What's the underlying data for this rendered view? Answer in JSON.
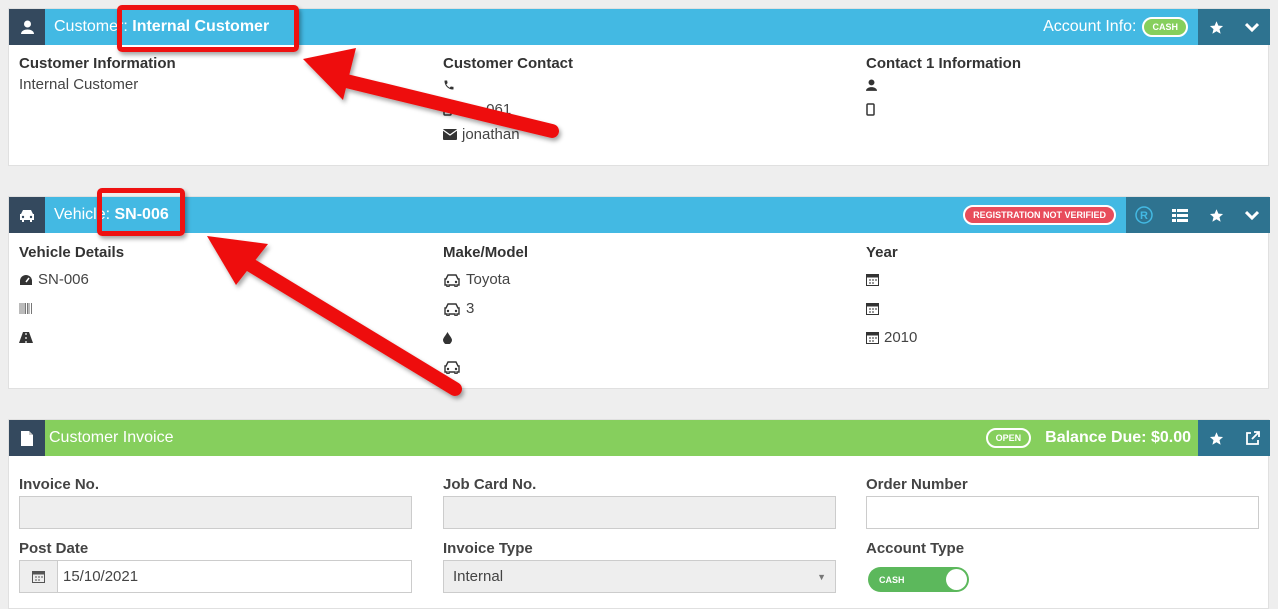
{
  "customer": {
    "title_prefix": "Customer: ",
    "title_name": "Internal Customer",
    "account_info_label": "Account Info:",
    "account_badge": "CASH",
    "col1_header": "Customer Information",
    "col1_value": "Internal Customer",
    "col2_header": "Customer Contact",
    "col2_mobile": "0 ... 061",
    "col2_email": "jonathan",
    "col3_header": "Contact 1 Information"
  },
  "vehicle": {
    "title_prefix": "Vehicle: ",
    "title_reg": "SN-006",
    "reg_badge": "REGISTRATION NOT VERIFIED",
    "col1_header": "Vehicle Details",
    "reg_value": "SN-006",
    "col2_header": "Make/Model",
    "make": "Toyota",
    "model": "3",
    "col3_header": "Year",
    "year": "2010"
  },
  "invoice": {
    "title": "Customer Invoice",
    "status_badge": "OPEN",
    "balance": "Balance Due: $0.00",
    "invoice_no_label": "Invoice No.",
    "job_card_label": "Job Card No.",
    "order_number_label": "Order Number",
    "post_date_label": "Post Date",
    "post_date_value": "15/10/2021",
    "invoice_type_label": "Invoice Type",
    "invoice_type_value": "Internal",
    "account_type_label": "Account Type",
    "account_type_value": "CASH"
  },
  "colors": {
    "customer_header": "#43b9e3",
    "vehicle_header": "#43b9e3",
    "invoice_header": "#86cf5d",
    "icon_tile": "#34495e",
    "action_tile": "#2e7390",
    "annotation_red": "#ee1111"
  }
}
